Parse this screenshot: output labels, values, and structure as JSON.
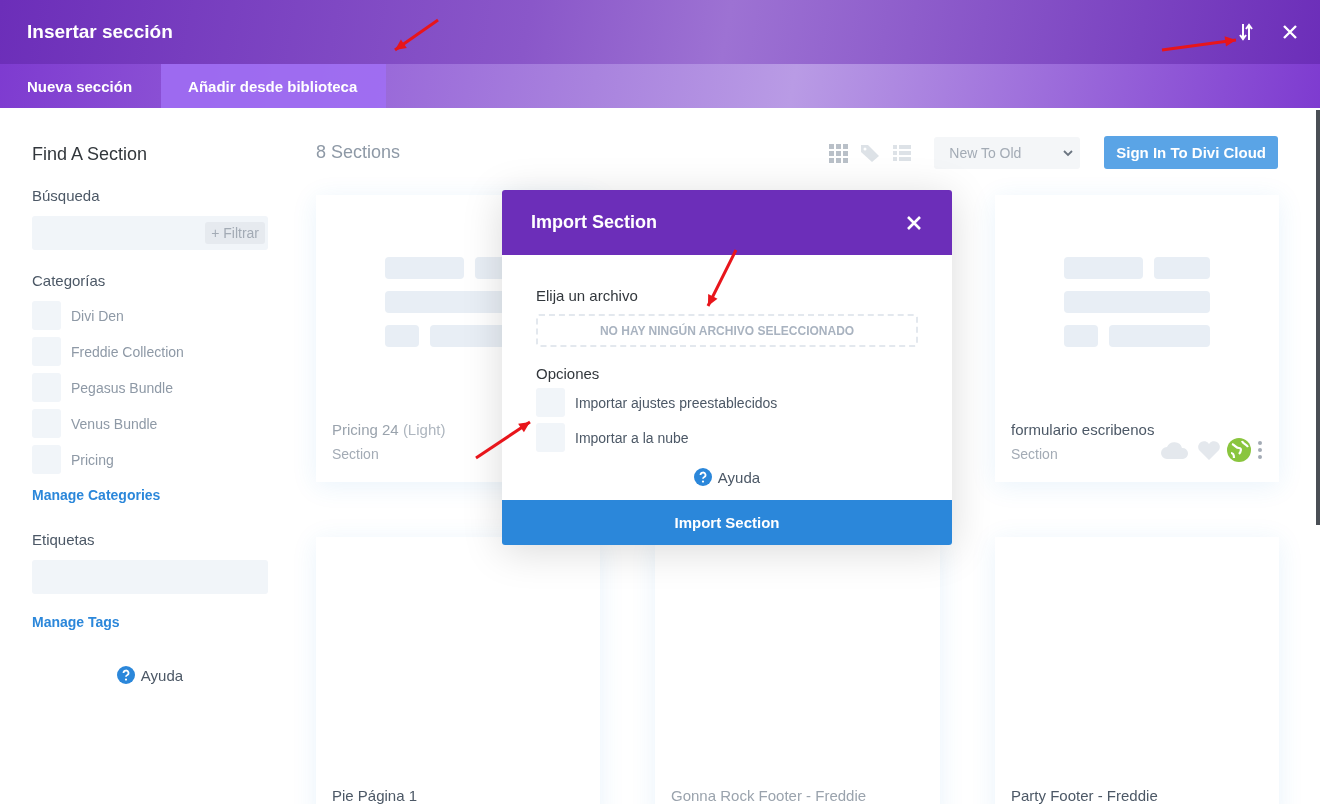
{
  "window": {
    "title": "Insertar sección"
  },
  "tabs": [
    {
      "label": "Nueva sección",
      "selected": false
    },
    {
      "label": "Añadir desde biblioteca",
      "selected": true
    }
  ],
  "sidebar": {
    "title": "Find A Section",
    "search_label": "Búsqueda",
    "filter_button": "+ Filtrar",
    "categories_label": "Categorías",
    "categories": [
      {
        "label": "Divi Den",
        "checked": false
      },
      {
        "label": "Freddie Collection",
        "checked": false
      },
      {
        "label": "Pegasus Bundle",
        "checked": false
      },
      {
        "label": "Venus Bundle",
        "checked": false
      },
      {
        "label": "Pricing",
        "checked": false
      }
    ],
    "manage_categories": "Manage Categories",
    "tags_label": "Etiquetas",
    "manage_tags": "Manage Tags",
    "help": "Ayuda"
  },
  "library": {
    "count": "8 Sections",
    "sort": "New To Old",
    "cloud_button": "Sign In To Divi Cloud",
    "cards": [
      {
        "kind": "skeleton",
        "title": "Pricing 24",
        "title_suffix": "(Light)",
        "subtitle": "Section",
        "faded": true
      },
      {
        "kind": "skeleton",
        "title": "formulario escribenos",
        "subtitle": "Section",
        "faded": false,
        "actions": true
      },
      {
        "kind": "blank",
        "title": "Pie Página 1",
        "faded": false
      },
      {
        "kind": "blank",
        "title": "Gonna Rock Footer - Freddie",
        "faded": true
      },
      {
        "kind": "blank",
        "title": "Party Footer - Freddie",
        "faded": false
      }
    ]
  },
  "modal": {
    "title": "Import Section",
    "file_label": "Elija un archivo",
    "file_placeholder": "NO HAY NINGÚN ARCHIVO SELECCIONADO",
    "options_label": "Opciones",
    "options": [
      {
        "label": "Importar ajustes preestablecidos",
        "checked": false
      },
      {
        "label": "Importar a la nube",
        "checked": false
      }
    ],
    "help": "Ayuda",
    "submit": "Import Section"
  }
}
